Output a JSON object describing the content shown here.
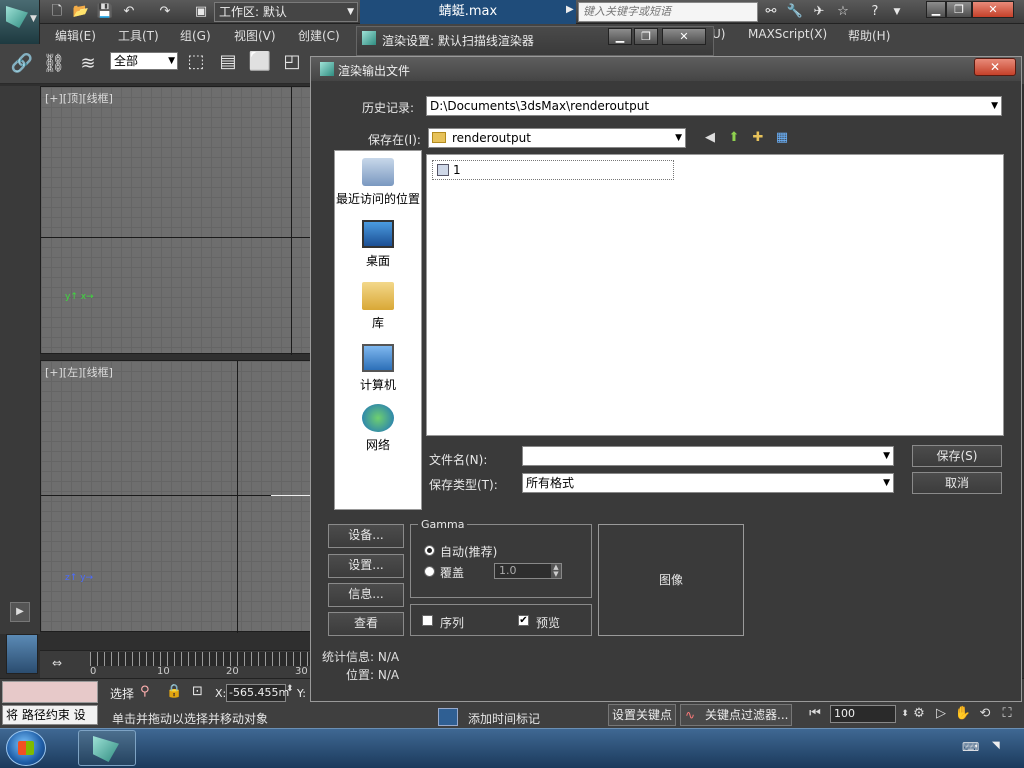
{
  "app": {
    "document_title": "蜻蜓.max",
    "workspace_label": "工作区: 默认",
    "search_placeholder": "键入关键字或短语"
  },
  "menu": {
    "items": [
      "编辑(E)",
      "工具(T)",
      "组(G)",
      "视图(V)",
      "创建(C)",
      "U)",
      "MAXScript(X)",
      "帮助(H)"
    ]
  },
  "toolbar": {
    "selection_filter": "全部"
  },
  "viewports": {
    "top_label": "[+][顶][线框]",
    "left_label": "[+][左][线框]"
  },
  "timeline": {
    "ticks": [
      "0",
      "10",
      "20",
      "30"
    ]
  },
  "status": {
    "prompt_line": "将 路径约束 设",
    "select_label": "选择",
    "x_label": "X:",
    "x_value": "-565.455m",
    "y_label": "Y:",
    "hint": "单击并拖动以选择并移动对象",
    "add_time_tag": "添加时间标记",
    "set_key": "设置关键点",
    "key_filters": "关键点过滤器...",
    "frame_value": "100"
  },
  "render_setup": {
    "title": "渲染设置: 默认扫描线渲染器"
  },
  "dialog": {
    "title": "渲染输出文件",
    "history_label": "历史记录:",
    "history_value": "D:\\Documents\\3dsMax\\renderoutput",
    "save_in_label": "保存在(I):",
    "save_in_value": "renderoutput",
    "places": [
      {
        "label": "最近访问的位置",
        "icon": "recent-places-icon"
      },
      {
        "label": "桌面",
        "icon": "desktop-icon"
      },
      {
        "label": "库",
        "icon": "libraries-icon"
      },
      {
        "label": "计算机",
        "icon": "computer-icon"
      },
      {
        "label": "网络",
        "icon": "network-icon"
      }
    ],
    "files": [
      {
        "name": "1"
      }
    ],
    "filename_label": "文件名(N):",
    "filename_value": "",
    "filetype_label": "保存类型(T):",
    "filetype_value": "所有格式",
    "save_button": "保存(S)",
    "cancel_button": "取消",
    "devices_button": "设备...",
    "setup_button": "设置...",
    "info_button": "信息...",
    "view_button": "查看",
    "gamma": {
      "title": "Gamma",
      "auto_label": "自动(推荐)",
      "override_label": "覆盖",
      "override_value": "1.0",
      "selected": "auto"
    },
    "sequence_label": "序列",
    "sequence_checked": false,
    "preview_label": "预览",
    "preview_checked": true,
    "image_label": "图像",
    "stats_label": "统计信息: N/A",
    "location_label": "位置: N/A"
  }
}
